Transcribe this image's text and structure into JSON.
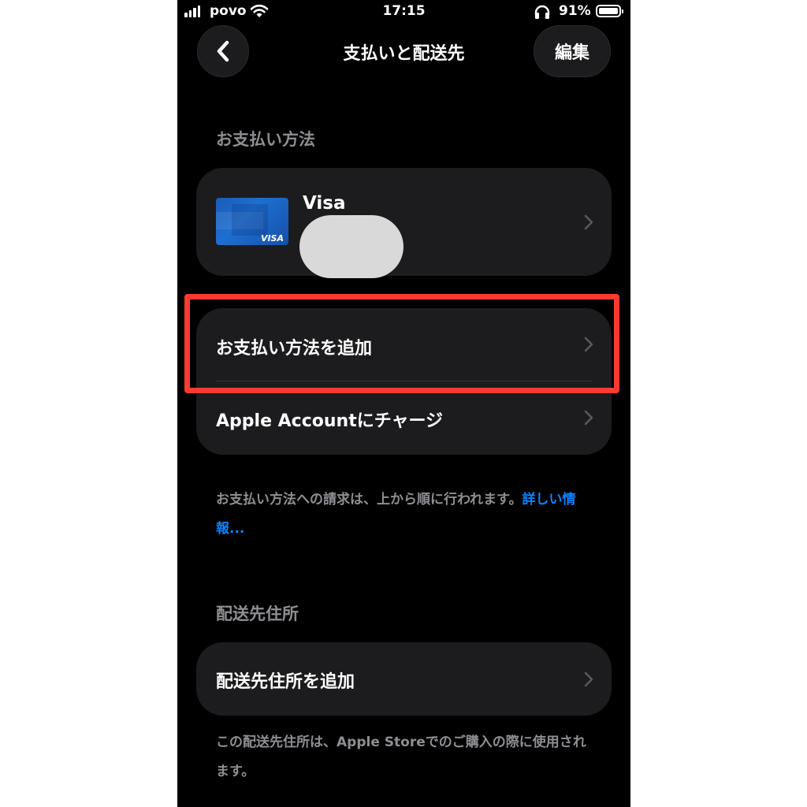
{
  "status_bar": {
    "carrier": "povo",
    "time": "17:15",
    "battery_percent": "91%",
    "signal_bars": 4,
    "icons": [
      "signal-icon",
      "wifi-icon",
      "headphones-icon",
      "battery-icon"
    ]
  },
  "nav": {
    "title": "支払いと配送先",
    "edit_label": "編集",
    "back_icon": "chevron-left-icon"
  },
  "payment": {
    "section_title": "お支払い方法",
    "card_name": "Visa",
    "card_brand_text": "VISA",
    "add_method_label": "お支払い方法を追加",
    "charge_label": "Apple Accountにチャージ",
    "footnote_text": "お支払い方法への請求は、上から順に行われます。",
    "footnote_link": "詳しい情報..."
  },
  "shipping": {
    "section_title": "配送先住所",
    "add_address_label": "配送先住所を追加",
    "footnote_text": "この配送先住所は、Apple Storeでのご購入の際に使用されます。"
  },
  "colors": {
    "background": "#000000",
    "card": "#1c1c1e",
    "secondary_text": "#8e8e93",
    "link": "#0a84ff",
    "highlight": "#ff3b30"
  }
}
